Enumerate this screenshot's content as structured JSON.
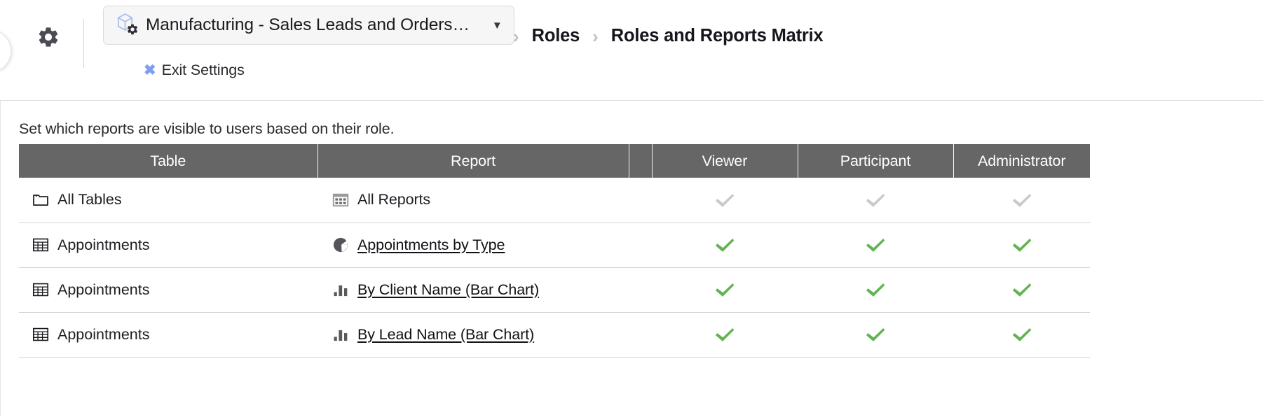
{
  "topbar": {
    "gear_icon": "gear-icon",
    "app_selector": {
      "icon": "cube-with-gear-icon",
      "label": "Manufacturing - Sales Leads and Orders…",
      "caret": "▼"
    },
    "exit_settings": {
      "icon": "close-x-icon",
      "icon_glyph": "✖",
      "label": "Exit Settings",
      "icon_color": "#7f9ef0"
    },
    "breadcrumb": {
      "separator": "›",
      "items": [
        {
          "label": "Roles",
          "current": false
        },
        {
          "label": "Roles and Reports Matrix",
          "current": true
        }
      ]
    }
  },
  "main": {
    "subtitle": "Set which reports are visible to users based on their role.",
    "table": {
      "header_bg": "#666666",
      "columns": [
        {
          "key": "table",
          "label": "Table"
        },
        {
          "key": "report",
          "label": "Report"
        },
        {
          "key": "spacer",
          "label": ""
        },
        {
          "key": "viewer",
          "label": "Viewer"
        },
        {
          "key": "participant",
          "label": "Participant"
        },
        {
          "key": "administrator",
          "label": "Administrator"
        }
      ],
      "check_colors": {
        "enabled": "#63b353",
        "disabled": "#c9c9c9"
      },
      "rows": [
        {
          "table_icon": "folder-icon",
          "table": "All Tables",
          "report_icon": "grid-report-icon",
          "report": "All Reports",
          "report_is_link": false,
          "viewer": "disabled",
          "participant": "disabled",
          "administrator": "disabled"
        },
        {
          "table_icon": "table-grid-icon",
          "table": "Appointments",
          "report_icon": "pie-chart-icon",
          "report": "Appointments by Type",
          "report_is_link": true,
          "viewer": "enabled",
          "participant": "enabled",
          "administrator": "enabled"
        },
        {
          "table_icon": "table-grid-icon",
          "table": "Appointments",
          "report_icon": "bar-chart-icon",
          "report": "By Client Name (Bar Chart)",
          "report_is_link": true,
          "viewer": "enabled",
          "participant": "enabled",
          "administrator": "enabled"
        },
        {
          "table_icon": "table-grid-icon",
          "table": "Appointments",
          "report_icon": "bar-chart-icon",
          "report": "By Lead Name (Bar Chart)",
          "report_is_link": true,
          "viewer": "enabled",
          "participant": "enabled",
          "administrator": "enabled"
        }
      ]
    }
  }
}
